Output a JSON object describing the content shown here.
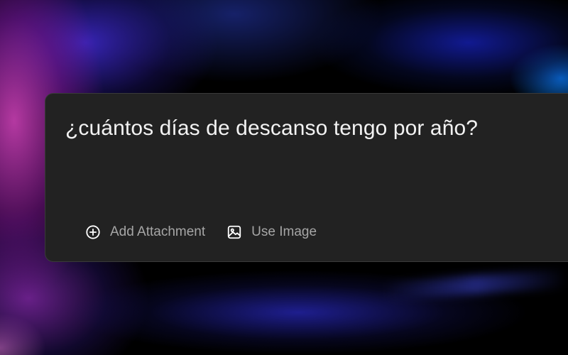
{
  "background": {
    "colors": [
      "#000000",
      "#be3caa",
      "#3c28c8",
      "#0a6edc"
    ]
  },
  "composer": {
    "prompt_text": "¿cuántos días de descanso tengo por año?",
    "background_color": "#222222",
    "actions": [
      {
        "label": "Add Attachment",
        "icon": "plus-circle-icon"
      },
      {
        "label": "Use Image",
        "icon": "image-icon"
      }
    ]
  }
}
